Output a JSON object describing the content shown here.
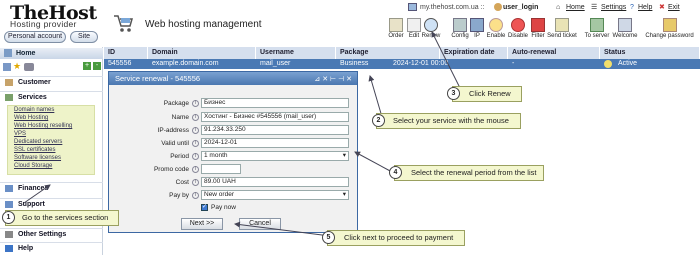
{
  "header": {
    "logo_text": "TheHost",
    "tagline": "Hosting provider",
    "personal_account": "Personal account",
    "site": "Site",
    "title": "Web hosting management",
    "account_host": "my.thehost.com.ua ::",
    "account_user": "user_login",
    "home": "Home",
    "settings": "Settings",
    "help": "Help",
    "exit": "Exit",
    "toolbar": [
      "Order",
      "Edit",
      "Renew",
      "Config",
      "IP",
      "Enable",
      "Disable",
      "Filter",
      "Send ticket",
      "To server",
      "Welcome",
      "Change password"
    ]
  },
  "sidebar": {
    "home": "Home",
    "sections": [
      "Customer",
      "Services",
      "Finances",
      "Support",
      "Other Settings",
      "Help"
    ],
    "services_items": [
      "Domain names",
      "Web Hosting",
      "Web Hosting reselling",
      "VPS",
      "Dedicated servers",
      "SSL certificates",
      "Software licenses",
      "Cloud Storage"
    ]
  },
  "table": {
    "columns": [
      "ID",
      "Domain",
      "Username",
      "Package",
      "Expiration date",
      "Auto-renewal",
      "Status"
    ],
    "row": [
      "545556",
      "example.domain.com",
      "mail_user",
      "Business",
      "2024-12-01 00:00",
      "-",
      "Active"
    ]
  },
  "dialog": {
    "title": "Service renewal - 545556",
    "fields": [
      {
        "label": "Package",
        "value": "Бизнес"
      },
      {
        "label": "Name",
        "value": "Хостинг - Бизнес #545556 (mail_user)"
      },
      {
        "label": "IP-address",
        "value": "91.234.33.250"
      },
      {
        "label": "Valid until",
        "value": "2024-12-01"
      },
      {
        "label": "Period",
        "value": "1 month"
      },
      {
        "label": "Promo code",
        "value": ""
      },
      {
        "label": "Cost",
        "value": "89.00 UAH"
      },
      {
        "label": "Pay by",
        "value": "New order"
      }
    ],
    "pay_now": "Pay now",
    "next": "Next >>",
    "cancel": "Cancel"
  },
  "callouts": [
    {
      "num": "1",
      "text": "Go to the services section"
    },
    {
      "num": "2",
      "text": "Select your service with the mouse"
    },
    {
      "num": "3",
      "text": "Click Renew"
    },
    {
      "num": "4",
      "text": "Select the renewal period from the list"
    },
    {
      "num": "5",
      "text": "Click next to proceed to payment"
    }
  ],
  "colors": {
    "accent": "#4a79b4",
    "callout_bg": "#f4f7cf",
    "sub_bg": "#eef3c9"
  }
}
